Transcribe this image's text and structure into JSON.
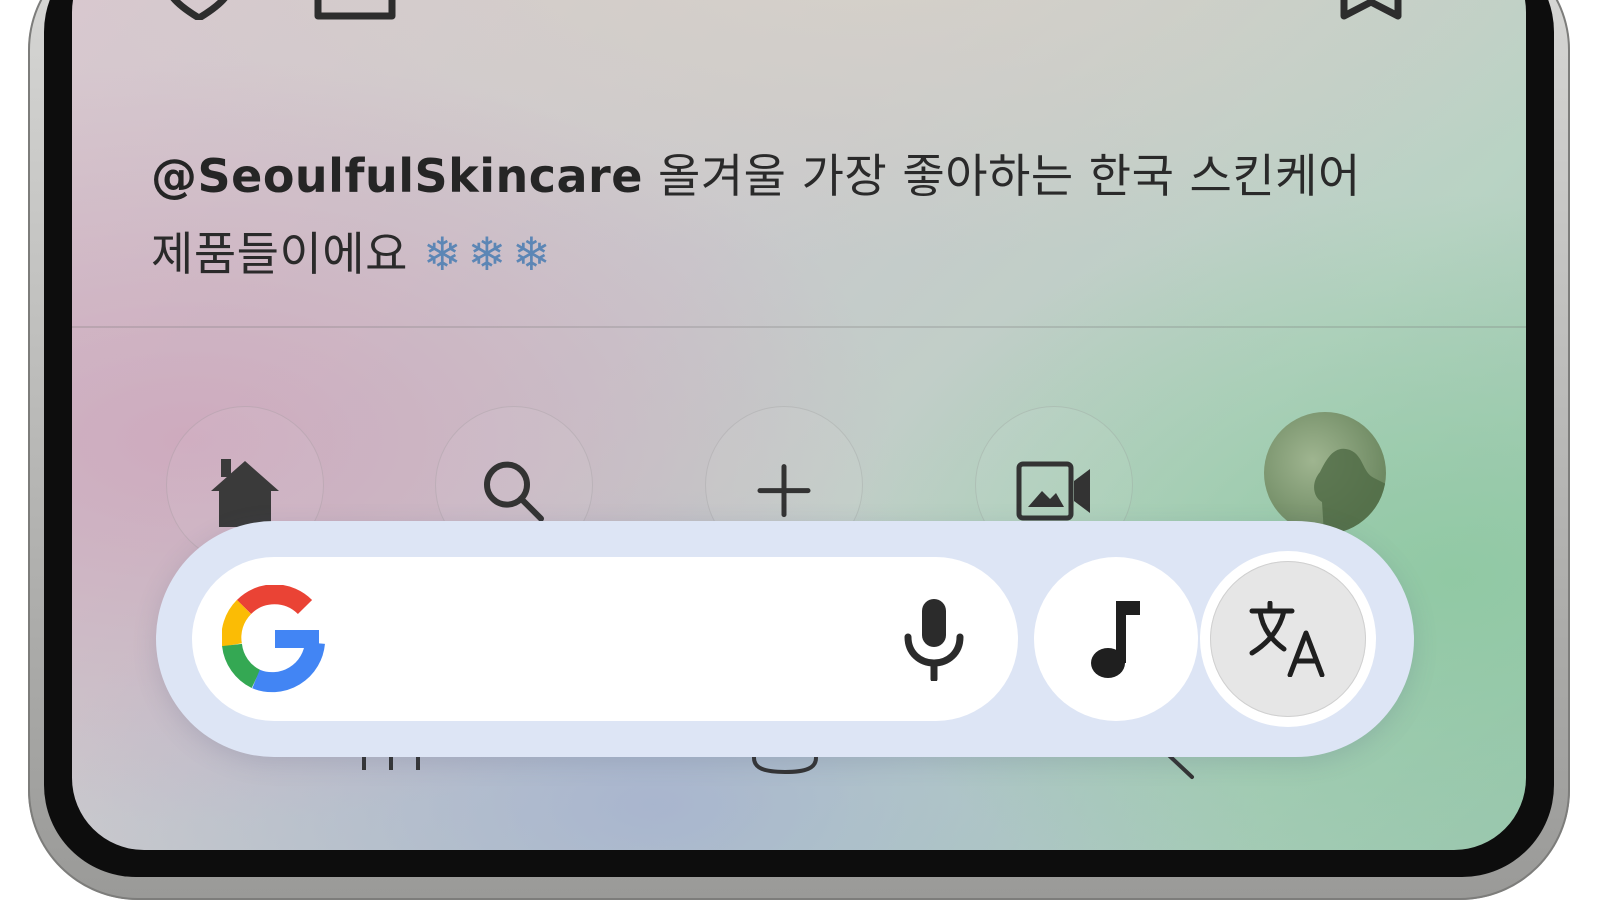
{
  "post": {
    "handle": "@SeoulfulSkincare",
    "caption": " 올겨울 가장 좋아하는 한국 스킨케어 제품들이에요",
    "emojis": "❄❄❄"
  },
  "bottom_nav": {
    "items": [
      {
        "icon": "home-icon"
      },
      {
        "icon": "search-icon"
      },
      {
        "icon": "add-icon"
      },
      {
        "icon": "reels-icon"
      },
      {
        "icon": "profile-avatar"
      }
    ]
  },
  "search_bar": {
    "logo": "google-g-logo",
    "mic_icon": "mic-icon",
    "music_icon": "music-note-icon",
    "translate_icon": "translate-icon"
  },
  "colors": {
    "pill_background": "#dde5f5",
    "text": "#2a2a2a",
    "google_blue": "#4285F4",
    "google_red": "#EA4335",
    "google_yellow": "#FBBC05",
    "google_green": "#34A853"
  }
}
